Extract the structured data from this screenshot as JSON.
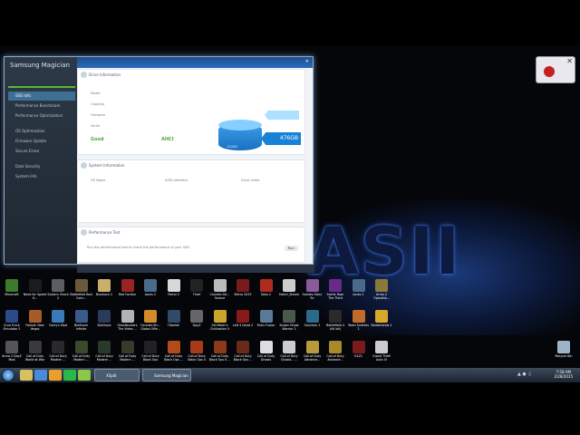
{
  "magician": {
    "title": "Samsung Magician",
    "nav": [
      {
        "label": "SSD Info",
        "active": true
      },
      {
        "label": "Performance Benchmark",
        "active": false
      },
      {
        "label": "Performance Optimization",
        "active": false
      },
      {
        "label": "OS Optimization",
        "active": false
      },
      {
        "label": "Firmware Update",
        "active": false
      },
      {
        "label": "Secure Erase",
        "active": false
      },
      {
        "label": "Data Security",
        "active": false
      },
      {
        "label": "System Info",
        "active": false
      }
    ],
    "sections": {
      "drive_info": "Drive Information",
      "system_info": "System Information",
      "performance": "Performance Test"
    },
    "drive_labels": [
      "Model",
      "Capacity",
      "Firmware",
      "Serial"
    ],
    "badges": [
      "Good",
      "AHCI"
    ],
    "disk_used": "120GB",
    "disk_total": "476GB",
    "system_cols": [
      "OS Name",
      "SATA Interface",
      "Drive Letter"
    ],
    "perf_text": "Run the performance test to check the performance of your SSD.",
    "run_button": "Run"
  },
  "desktop_icons": [
    {
      "label": "Minecraft",
      "color": "#3c7a2c"
    },
    {
      "label": "Need for Speed H...",
      "color": "#1c1c1c"
    },
    {
      "label": "System Shock 2",
      "color": "#5b5e63"
    },
    {
      "label": "Battlefield Bad Com...",
      "color": "#6a5a3a"
    },
    {
      "label": "Bioshock 2",
      "color": "#c9b06a"
    },
    {
      "label": "Red Faction",
      "color": "#9a2424"
    },
    {
      "label": "Jones 2",
      "color": "#4a6a8a"
    },
    {
      "label": "Portal 2",
      "color": "#d8d8d8"
    },
    {
      "label": "Thief",
      "color": "#222"
    },
    {
      "label": "Counter-Str... Source",
      "color": "#bbb"
    },
    {
      "label": "Metro 2033",
      "color": "#7a1a1a"
    },
    {
      "label": "Dota 2",
      "color": "#b02a20"
    },
    {
      "label": "Hatch_Steam",
      "color": "#ccc"
    },
    {
      "label": "Sairoks Story Ex",
      "color": "#8a5a9a"
    },
    {
      "label": "Saints Row: The Third",
      "color": "#6a2a8a"
    },
    {
      "label": "Jones 2",
      "color": "#4a6a8a"
    },
    {
      "label": "Arma 2 Operatio...",
      "color": "#8a7a3a"
    },
    {
      "label": "Euro Truck Simulator 2",
      "color": "#2a4a8a"
    },
    {
      "label": "Fallout: New Vegas",
      "color": "#a85a2a"
    },
    {
      "label": "Garry's Mod",
      "color": "#3a7ab8"
    },
    {
      "label": "BioShock Infinite",
      "color": "#3a5a8a"
    },
    {
      "label": "BioShock",
      "color": "#2a3a5a"
    },
    {
      "label": "Ghostbusters The Video ...",
      "color": "#b2b2b2"
    },
    {
      "label": "Counter-Str... Global Offe...",
      "color": "#d48a2a"
    },
    {
      "label": "Titanfall",
      "color": "#324a6a"
    },
    {
      "label": "DayZ",
      "color": "#666"
    },
    {
      "label": "Sid Meier's Civilization V",
      "color": "#c9a62a"
    },
    {
      "label": "Left 4 Dead 2",
      "color": "#8a1a1a"
    },
    {
      "label": "Trials Fusion",
      "color": "#5a7a9a"
    },
    {
      "label": "Sniper Ghost Warrior 2",
      "color": "#4a5a4a"
    },
    {
      "label": "Sanctum 2",
      "color": "#2a6a8a"
    },
    {
      "label": "Battlefield 4 (64 bit)",
      "color": "#2a2a2a"
    },
    {
      "label": "Team Fortress 2",
      "color": "#c26a2a"
    },
    {
      "label": "Borderlands 2",
      "color": "#d8a82a"
    },
    {
      "label": "Arma 2 DayZ Mod",
      "color": "#555"
    },
    {
      "label": "Call of Duty World at War",
      "color": "#3a3a3a"
    },
    {
      "label": "Call of Duty Modern ...",
      "color": "#2a2a2a"
    },
    {
      "label": "Call of Duty Modern ...",
      "color": "#3a4a2a"
    },
    {
      "label": "Call of Duty Modern ...",
      "color": "#2a3a2a"
    },
    {
      "label": "Call of Duty Modern ...",
      "color": "#3a3a2a"
    },
    {
      "label": "Call of Duty Black Ops",
      "color": "#222"
    },
    {
      "label": "Call of Duty Black Ops ...",
      "color": "#b24a1a"
    },
    {
      "label": "Call of Duty Black Ops II",
      "color": "#a83a1a"
    },
    {
      "label": "Call of Duty Black Ops II ...",
      "color": "#8a3a1a"
    },
    {
      "label": "Call of Duty Black Ops ...",
      "color": "#6a2a1a"
    },
    {
      "label": "Call of Duty Ghosts",
      "color": "#ddd"
    },
    {
      "label": "Call of Duty Ghosts - ...",
      "color": "#ccc"
    },
    {
      "label": "Call of Duty Advance...",
      "color": "#b89a3a"
    },
    {
      "label": "Call of Duty Advance...",
      "color": "#a88a2a"
    },
    {
      "label": "H1Z1",
      "color": "#7a1a1a"
    },
    {
      "label": "Grand Theft Auto IV",
      "color": "#ccc"
    },
    {
      "label": "Killing Floor",
      "color": "#b21a1a"
    },
    {
      "label": "The Ship Tutorial",
      "color": "#9a6a3a"
    },
    {
      "label": "Arma 2 Operatio...",
      "color": "#8a7a3a"
    },
    {
      "label": "The Ship SinglePlayer",
      "color": "#8a5a2a"
    }
  ],
  "recycle_bin": "Recycle Bin",
  "taskbar": {
    "pins": [
      "#d8c060",
      "#4a8ad8",
      "#e8a02a",
      "#2ab84a",
      "#8ac84a"
    ],
    "windows": [
      "XSplit",
      "Samsung Magician"
    ],
    "time": "7:58 AM",
    "date": "2/28/2015"
  }
}
